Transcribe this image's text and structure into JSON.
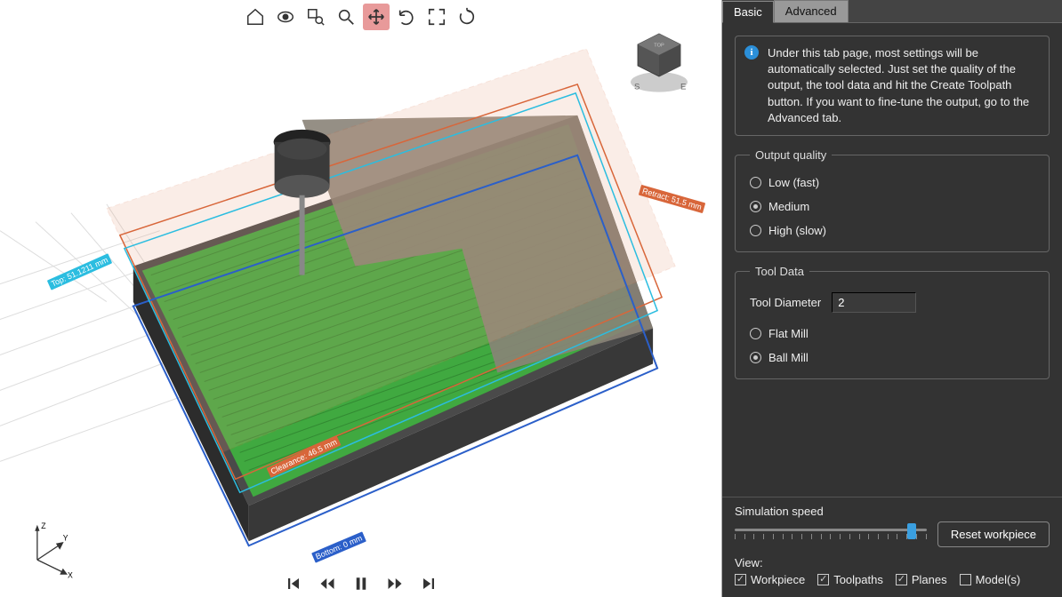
{
  "toolbar": {
    "items": [
      "home",
      "eye",
      "zoom-window",
      "zoom",
      "pan",
      "undo",
      "fit",
      "rotate"
    ],
    "active": "pan"
  },
  "viewcube": {
    "directions": {
      "s": "S",
      "e": "E",
      "top": "TOP"
    }
  },
  "axes": {
    "x": "X",
    "y": "Y",
    "z": "Z"
  },
  "playback": {
    "items": [
      "first",
      "rewind",
      "playpause",
      "forward",
      "last"
    ]
  },
  "planes": {
    "top": "Top: 51.1211 mm",
    "retract": "Retract: 51.5 mm",
    "clearance": "Clearance: 46.5 mm",
    "bottom": "Bottom: 0 mm"
  },
  "tabs": {
    "basic": "Basic",
    "advanced": "Advanced",
    "active": "basic"
  },
  "info": {
    "text": "Under this tab page, most settings will be automatically selected. Just set the quality of the output, the tool data and hit the Create Toolpath button. If you want to fine-tune the output, go to the Advanced tab."
  },
  "output_quality": {
    "legend": "Output quality",
    "options": [
      {
        "label": "Low (fast)",
        "checked": false
      },
      {
        "label": "Medium",
        "checked": true
      },
      {
        "label": "High (slow)",
        "checked": false
      }
    ]
  },
  "tool_data": {
    "legend": "Tool Data",
    "diameter_label": "Tool Diameter",
    "diameter_value": "2",
    "options": [
      {
        "label": "Flat Mill",
        "checked": false
      },
      {
        "label": "Ball Mill",
        "checked": true
      }
    ]
  },
  "simulation": {
    "label": "Simulation speed",
    "value_pct": 92,
    "reset_label": "Reset workpiece"
  },
  "view_checks": {
    "label": "View:",
    "options": [
      {
        "label": "Workpiece",
        "checked": true
      },
      {
        "label": "Toolpaths",
        "checked": true
      },
      {
        "label": "Planes",
        "checked": true
      },
      {
        "label": "Model(s)",
        "checked": false
      }
    ]
  }
}
